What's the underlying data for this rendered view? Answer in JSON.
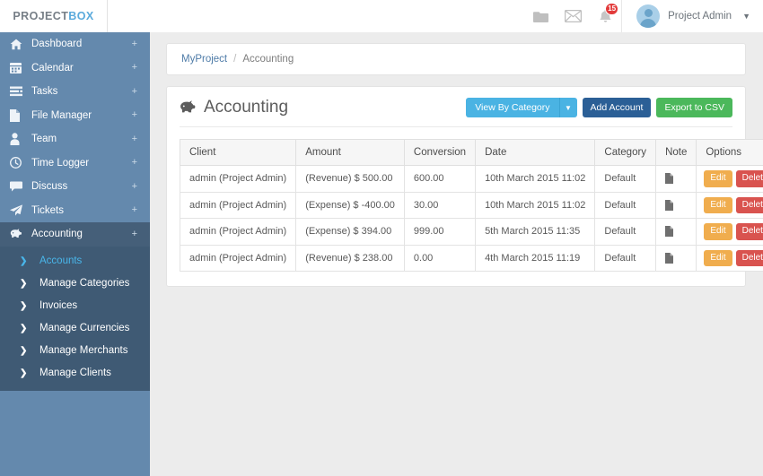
{
  "brand": {
    "part1": "PROJECT",
    "part2": "BOX",
    "accent": "#5aaadc"
  },
  "header": {
    "icons": [
      {
        "name": "folder-icon",
        "label": "Folder"
      },
      {
        "name": "envelope-icon",
        "label": "Messages"
      },
      {
        "name": "bell-icon",
        "label": "Notifications"
      }
    ],
    "notification_count": "15",
    "notification_badge_color": "#e23b3b",
    "user": {
      "name": "Project Admin",
      "caret": "⌄"
    }
  },
  "sidebar": {
    "bg": "#6489ad",
    "submenu_bg": "#3f5a74",
    "active_bg": "#455f79",
    "active_link_color": "#49b6ea",
    "expand_symbol": "+",
    "items": [
      {
        "label": "Dashboard",
        "icon": "home-icon",
        "active": false
      },
      {
        "label": "Calendar",
        "icon": "calendar-icon",
        "active": false
      },
      {
        "label": "Tasks",
        "icon": "tasks-icon",
        "active": false
      },
      {
        "label": "File Manager",
        "icon": "file-icon",
        "active": false
      },
      {
        "label": "Team",
        "icon": "user-icon",
        "active": false
      },
      {
        "label": "Time Logger",
        "icon": "clock-icon",
        "active": false
      },
      {
        "label": "Discuss",
        "icon": "comment-icon",
        "active": false
      },
      {
        "label": "Tickets",
        "icon": "paper-plane-icon",
        "active": false
      },
      {
        "label": "Accounting",
        "icon": "piggy-bank-icon",
        "active": true
      }
    ],
    "submenu": [
      {
        "label": "Accounts",
        "active": true
      },
      {
        "label": "Manage Categories",
        "active": false
      },
      {
        "label": "Invoices",
        "active": false
      },
      {
        "label": "Manage Currencies",
        "active": false
      },
      {
        "label": "Manage Merchants",
        "active": false
      },
      {
        "label": "Manage Clients",
        "active": false
      }
    ]
  },
  "breadcrumb": {
    "root": "MyProject",
    "separator": "/",
    "current": "Accounting"
  },
  "page": {
    "title": "Accounting",
    "title_icon": "piggy-bank-icon",
    "actions": {
      "view_by_category": {
        "label": "View By Category",
        "color": "#4ab3e3"
      },
      "add_account": {
        "label": "Add Account",
        "color": "#2b5f96"
      },
      "export_csv": {
        "label": "Export to CSV",
        "color": "#4bb85b"
      }
    }
  },
  "table": {
    "columns": [
      "Client",
      "Amount",
      "Conversion",
      "Date",
      "Category",
      "Note",
      "Options"
    ],
    "row_actions": {
      "edit": "Edit",
      "delete": "Delete",
      "edit_color": "#f0ad4e",
      "delete_color": "#d9534f"
    },
    "note_icon": "document-icon",
    "rows": [
      {
        "client": "admin (Project Admin)",
        "amount": "(Revenue) $ 500.00",
        "conversion": "600.00",
        "date": "10th March 2015 11:02",
        "category": "Default"
      },
      {
        "client": "admin (Project Admin)",
        "amount": "(Expense) $ -400.00",
        "conversion": "30.00",
        "date": "10th March 2015 11:02",
        "category": "Default"
      },
      {
        "client": "admin (Project Admin)",
        "amount": "(Expense) $ 394.00",
        "conversion": "999.00",
        "date": "5th March 2015 11:35",
        "category": "Default"
      },
      {
        "client": "admin (Project Admin)",
        "amount": "(Revenue) $ 238.00",
        "conversion": "0.00",
        "date": "4th March 2015 11:19",
        "category": "Default"
      }
    ]
  }
}
